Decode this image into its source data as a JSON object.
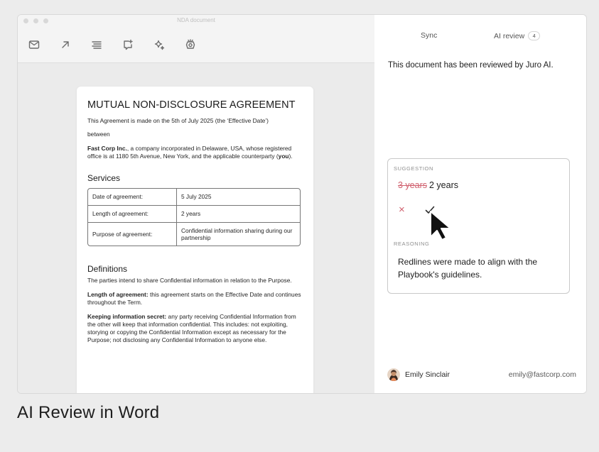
{
  "window": {
    "title": "NDA document"
  },
  "toolbar": {
    "tools": [
      "mail-icon",
      "arrow-up-right-icon",
      "align-icon",
      "comment-add-icon",
      "sparkle-icon",
      "badge-icon"
    ]
  },
  "document": {
    "title": "MUTUAL NON-DISCLOSURE AGREEMENT",
    "intro": "This Agreement is made on the 5th of July 2025 (the ‘Effective Date’)",
    "between": "between",
    "party_name": "Fast Corp Inc.",
    "party_desc_1": ", a company incorporated in Delaware, USA, whose registered office is at 1180 5th Avenue, New York, and the applicable counterparty (",
    "party_you": "you",
    "party_desc_2": ").",
    "services_heading": "Services",
    "table": [
      {
        "key": "Date of agreement:",
        "value": "5 July 2025"
      },
      {
        "key": "Length of agreement:",
        "value": "2 years"
      },
      {
        "key": "Purpose of agreement:",
        "value": "Confidential information sharing during our partnership"
      }
    ],
    "definitions_heading": "Definitions",
    "def_intro": "The parties intend to share Confidential information in relation to the Purpose.",
    "def1_term": "Length of agreement:",
    "def1_text": " this agreement starts on the Effective Date and continues throughout the Term.",
    "def2_term": "Keeping information secret:",
    "def2_text": " any party receiving Confidential Information from the other will keep that information confidential. This includes: not exploiting, storying or copying the Confidential Information except as necessary for the Purpose; not disclosing any Confidential Information to anyone else."
  },
  "panel": {
    "tab_sync": "Sync",
    "tab_ai_review": "AI review",
    "ai_review_count": "4",
    "reviewed_message": "This document has been reviewed by Juro AI.",
    "suggestion_label": "SUGGESTION",
    "suggestion_removed": "3 years",
    "suggestion_added": "2 years",
    "reject_icon": "×",
    "reasoning_label": "REASONING",
    "reasoning_text": "Redlines were made to align with the Playbook's guidelines.",
    "user_name": "Emily Sinclair",
    "user_email": "emily@fastcorp.com"
  },
  "caption": "AI Review in Word",
  "colors": {
    "accent_red": "#d0606e",
    "panel_bg": "#ffffff",
    "word_bg": "#ebebeb"
  }
}
